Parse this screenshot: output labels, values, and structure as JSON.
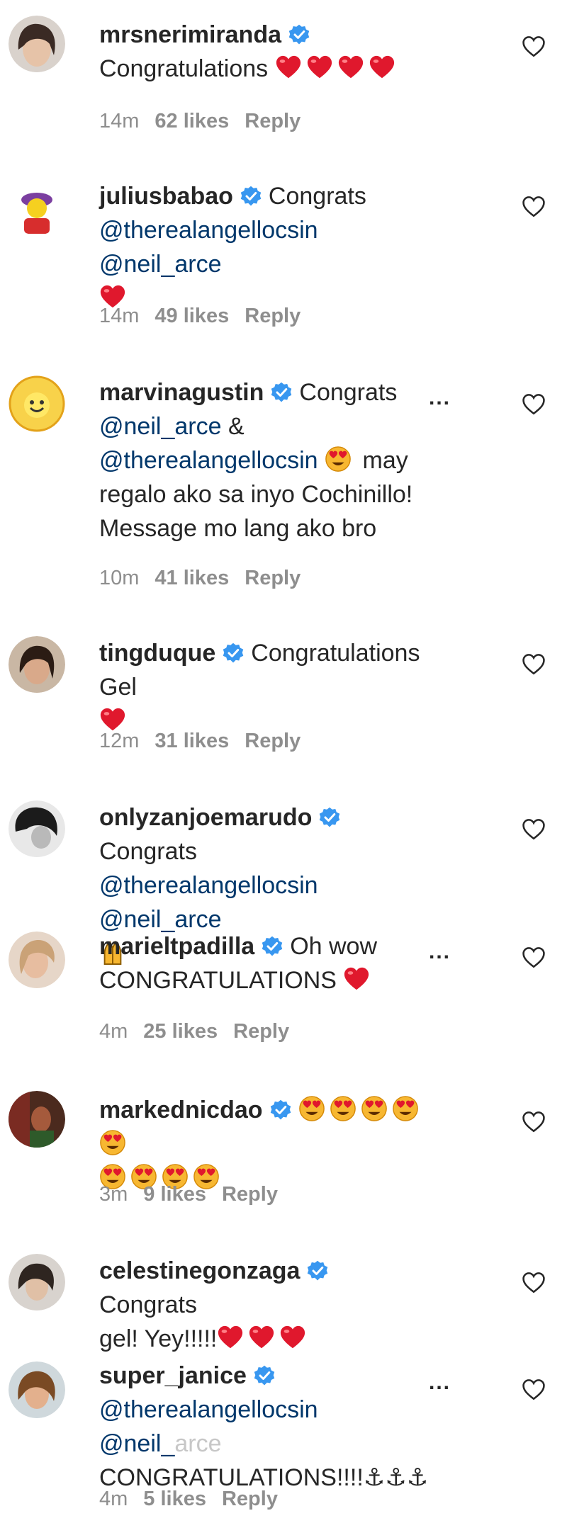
{
  "comments": [
    {
      "user": "mrsnerimiranda",
      "line1": "Congratulations",
      "time": "14m",
      "likes": "62 likes",
      "reply": "Reply"
    },
    {
      "user": "juliusbabao",
      "text1": "Congrats",
      "mention1": "@therealangellocsin",
      "mention2": "@neil_arce",
      "time": "14m",
      "likes": "49 likes",
      "reply": "Reply"
    },
    {
      "user": "marvinagustin",
      "text1": "Congrats",
      "mention1": "@neil_arce",
      "amp": "&",
      "mention2": "@therealangellocsin",
      "text2": "may",
      "text3": "regalo ako sa inyo Cochinillo!",
      "text4": "Message mo lang ako bro",
      "time": "10m",
      "likes": "41 likes",
      "reply": "Reply",
      "more": "..."
    },
    {
      "user": "tingduque",
      "text1": "Congratulations Gel",
      "time": "12m",
      "likes": "31 likes",
      "reply": "Reply"
    },
    {
      "user": "onlyzanjoemarudo",
      "text1": "Congrats",
      "mention1": "@therealangellocsin",
      "mention2": "@neil_arce"
    },
    {
      "user": "marieltpadilla",
      "text1": "Oh wow",
      "text2": "CONGRATULATIONS",
      "time": "4m",
      "likes": "25 likes",
      "reply": "Reply",
      "more": "..."
    },
    {
      "user": "markednicdao",
      "time": "3m",
      "likes": "9 likes",
      "reply": "Reply"
    },
    {
      "user": "celestinegonzaga",
      "text1": "Congrats",
      "text2": "gel! Yey!!!!!"
    },
    {
      "user": "super_janice",
      "mention1": "@therealangellocsin",
      "mention2a": "@neil_",
      "mention2b": "arce",
      "text2": "CONGRATULATIONS!!!!⚓⚓⚓",
      "time": "4m",
      "likes": "5 likes",
      "reply": "Reply",
      "more": "..."
    }
  ],
  "colors": {
    "text": "#262626",
    "meta": "#8e8e8e",
    "mention": "#00376b",
    "verified": "#3897f0",
    "heart": "#e0182d"
  },
  "icons": {
    "verified": "verified-badge-icon",
    "like": "heart-outline-icon",
    "emoji_heart": "red-heart-emoji",
    "emoji_eyes": "heart-eyes-emoji",
    "emoji_hands": "raised-hands-emoji"
  }
}
